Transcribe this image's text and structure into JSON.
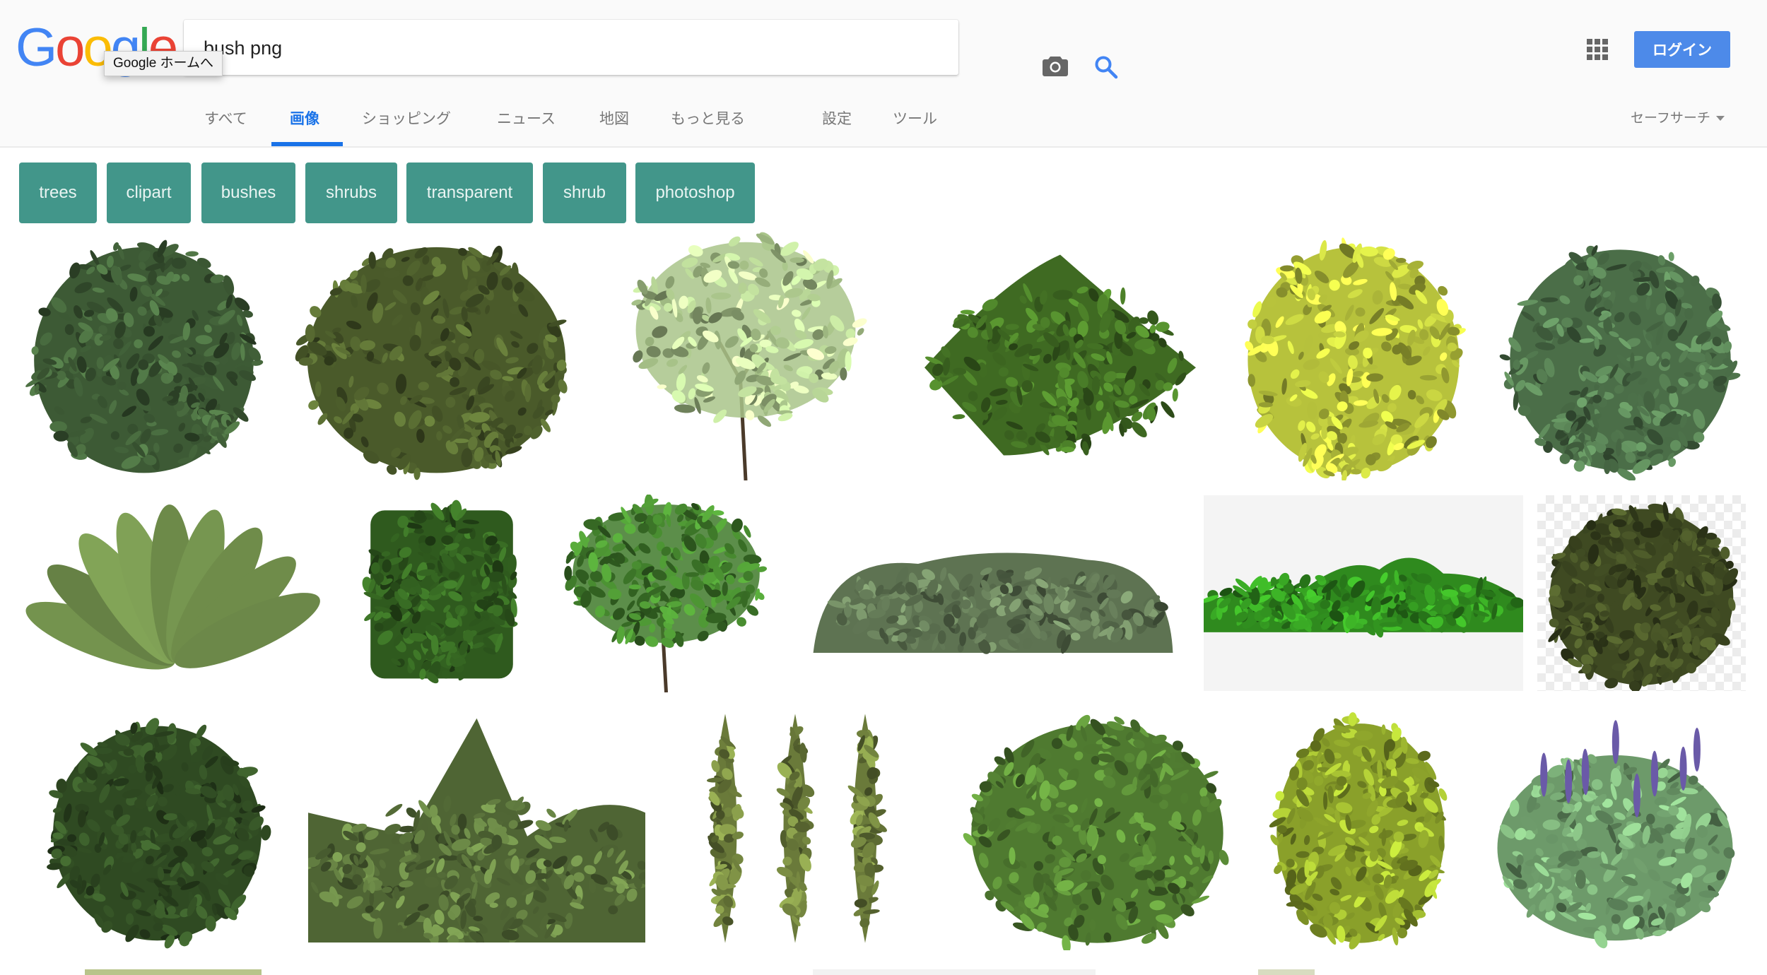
{
  "header": {
    "logo_letters": [
      "G",
      "o",
      "o",
      "g",
      "l",
      "e"
    ],
    "logo_colors": [
      "#4285f4",
      "#ea4335",
      "#fbbc05",
      "#4285f4",
      "#34a853",
      "#ea4335"
    ],
    "logo_tooltip": "Google ホームへ",
    "search": {
      "value": "bush png",
      "placeholder": ""
    },
    "camera_icon": "camera-icon",
    "search_icon": "search-icon",
    "apps_icon": "apps-grid-icon",
    "login_label": "ログイン",
    "accent_color": "#1a73e8",
    "login_color": "#4d8ae9"
  },
  "tabs": [
    {
      "label": "すべて",
      "active": false
    },
    {
      "label": "画像",
      "active": true
    },
    {
      "label": "ショッピング",
      "active": false
    },
    {
      "label": "ニュース",
      "active": false
    },
    {
      "label": "地図",
      "active": false
    },
    {
      "label": "もっと見る",
      "active": false
    },
    {
      "label": "設定",
      "active": false
    },
    {
      "label": "ツール",
      "active": false
    }
  ],
  "safesearch_label": "セーフサーチ",
  "chips": {
    "color": "#42968a",
    "items": [
      "trees",
      "clipart",
      "bushes",
      "shrubs",
      "transparent",
      "shrub",
      "photoshop"
    ]
  },
  "results": {
    "rows": [
      [
        {
          "alt": "dark green leafy bush",
          "color": "#3d5a35"
        },
        {
          "alt": "round olive bush",
          "color": "#4a5a2a"
        },
        {
          "alt": "light green willow shrub",
          "color": "#a9c48a"
        },
        {
          "alt": "spreading green shrub",
          "color": "#3f6a22"
        },
        {
          "alt": "yellow-green shrub",
          "color": "#b7c23c"
        },
        {
          "alt": "round dark green bush",
          "color": "#4b6e48"
        }
      ],
      [
        {
          "alt": "fern",
          "color": "#7a9a52"
        },
        {
          "alt": "square hedge",
          "color": "#2f5a1e"
        },
        {
          "alt": "small tree",
          "color": "#3f7a2a"
        },
        {
          "alt": "low hedge row",
          "color": "#5e7352"
        },
        {
          "alt": "green hedges on gray background",
          "color": "#2f8a1e"
        },
        {
          "alt": "bush on transparent checkerboard",
          "color": "#3f4a22"
        }
      ],
      [
        {
          "alt": "dense dark bush",
          "color": "#2f4a22"
        },
        {
          "alt": "tree tops photo",
          "color": "#58703a"
        },
        {
          "alt": "three cypress trees",
          "color": "#6a7a3a"
        },
        {
          "alt": "hydrangea bush",
          "color": "#4f7a30"
        },
        {
          "alt": "yellow-green leafy plant",
          "color": "#8aa02a"
        },
        {
          "alt": "lavender bush",
          "color": "#6d9a6a"
        }
      ]
    ]
  }
}
